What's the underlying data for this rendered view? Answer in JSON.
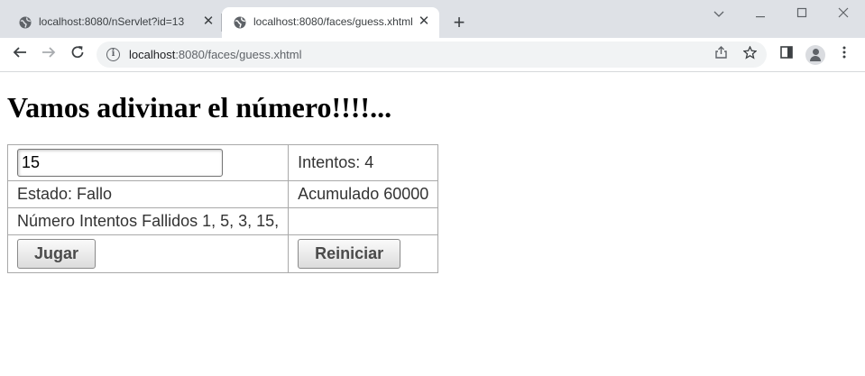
{
  "browser": {
    "tabs": [
      {
        "title": "localhost:8080/nServlet?id=13",
        "active": false
      },
      {
        "title": "localhost:8080/faces/guess.xhtml",
        "active": true
      }
    ],
    "address": {
      "host": "localhost",
      "path": ":8080/faces/guess.xhtml"
    },
    "icons": {
      "tab_favicon": "globe-icon",
      "tab_close": "close-icon",
      "new_tab": "plus-icon",
      "back": "arrow-left-icon",
      "forward": "arrow-right-icon",
      "reload": "reload-icon",
      "site_info": "info-icon",
      "share": "share-icon",
      "bookmark": "star-icon",
      "side_panel": "side-panel-icon",
      "profile": "avatar-icon",
      "menu": "kebab-menu-icon"
    }
  },
  "page": {
    "title": "Vamos adivinar el número!!!!...",
    "guess_input": {
      "value": "15"
    },
    "attempts_label": "Intentos: 4",
    "status_label": "Estado: Fallo",
    "accumulated_label": "Acumulado 60000",
    "failed_attempts_label": "Número Intentos Fallidos 1, 5, 3, 15,",
    "play_button": "Jugar",
    "reset_button": "Reiniciar"
  }
}
